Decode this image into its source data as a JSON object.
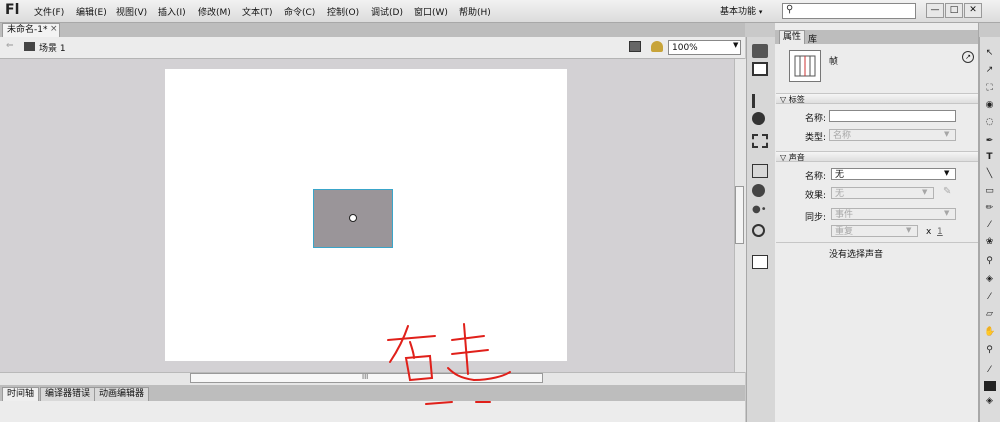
{
  "app": {
    "logo": "Fl",
    "menu": [
      "文件(F)",
      "编辑(E)",
      "视图(V)",
      "插入(I)",
      "修改(M)",
      "文本(T)",
      "命令(C)",
      "控制(O)",
      "调试(D)",
      "窗口(W)",
      "帮助(H)"
    ],
    "workspace": "基本功能",
    "window_buttons": [
      "—",
      "□",
      "✕"
    ]
  },
  "document": {
    "tab": "未命名-1*",
    "close": "×"
  },
  "scene": {
    "label": "场景 1",
    "zoom": "100%"
  },
  "bottom_tabs": [
    "时间轴",
    "编译器错误",
    "动画编辑器"
  ],
  "properties": {
    "tabs": [
      "属性",
      "库"
    ],
    "frame_label": "帧",
    "label_section": {
      "title": "标签",
      "name_label": "名称:",
      "name_value": "",
      "type_label": "类型:",
      "type_value": "名称"
    },
    "sound_section": {
      "title": "声音",
      "name_label": "名称:",
      "name_value": "无",
      "effect_label": "效果:",
      "effect_value": "无",
      "sync_label": "同步:",
      "sync_value": "事件",
      "repeat_value": "重复",
      "repeat_x": "x",
      "repeat_count": "1",
      "no_sound": "没有选择声音"
    }
  },
  "annotation": {
    "text": "右击"
  },
  "colors": {
    "stage": "#ffffff",
    "pasteboard": "#d3d1d4",
    "symbol_fill": "#9a9599",
    "symbol_outline": "#3aa5c9",
    "annotation_ink": "#e0201a"
  },
  "icons": [
    "search-icon",
    "scene-icon",
    "edit-scene-icon",
    "edit-symbol-icon",
    "help-icon",
    "selection-tool-icon",
    "subselection-tool-icon",
    "free-transform-icon",
    "3d-rotation-icon",
    "lasso-icon",
    "pen-icon",
    "text-tool-icon",
    "line-tool-icon",
    "rectangle-tool-icon",
    "pencil-icon",
    "brush-icon",
    "deco-icon",
    "bone-icon",
    "paint-bucket-icon",
    "eyedropper-icon",
    "eraser-icon",
    "hand-icon",
    "zoom-icon"
  ]
}
